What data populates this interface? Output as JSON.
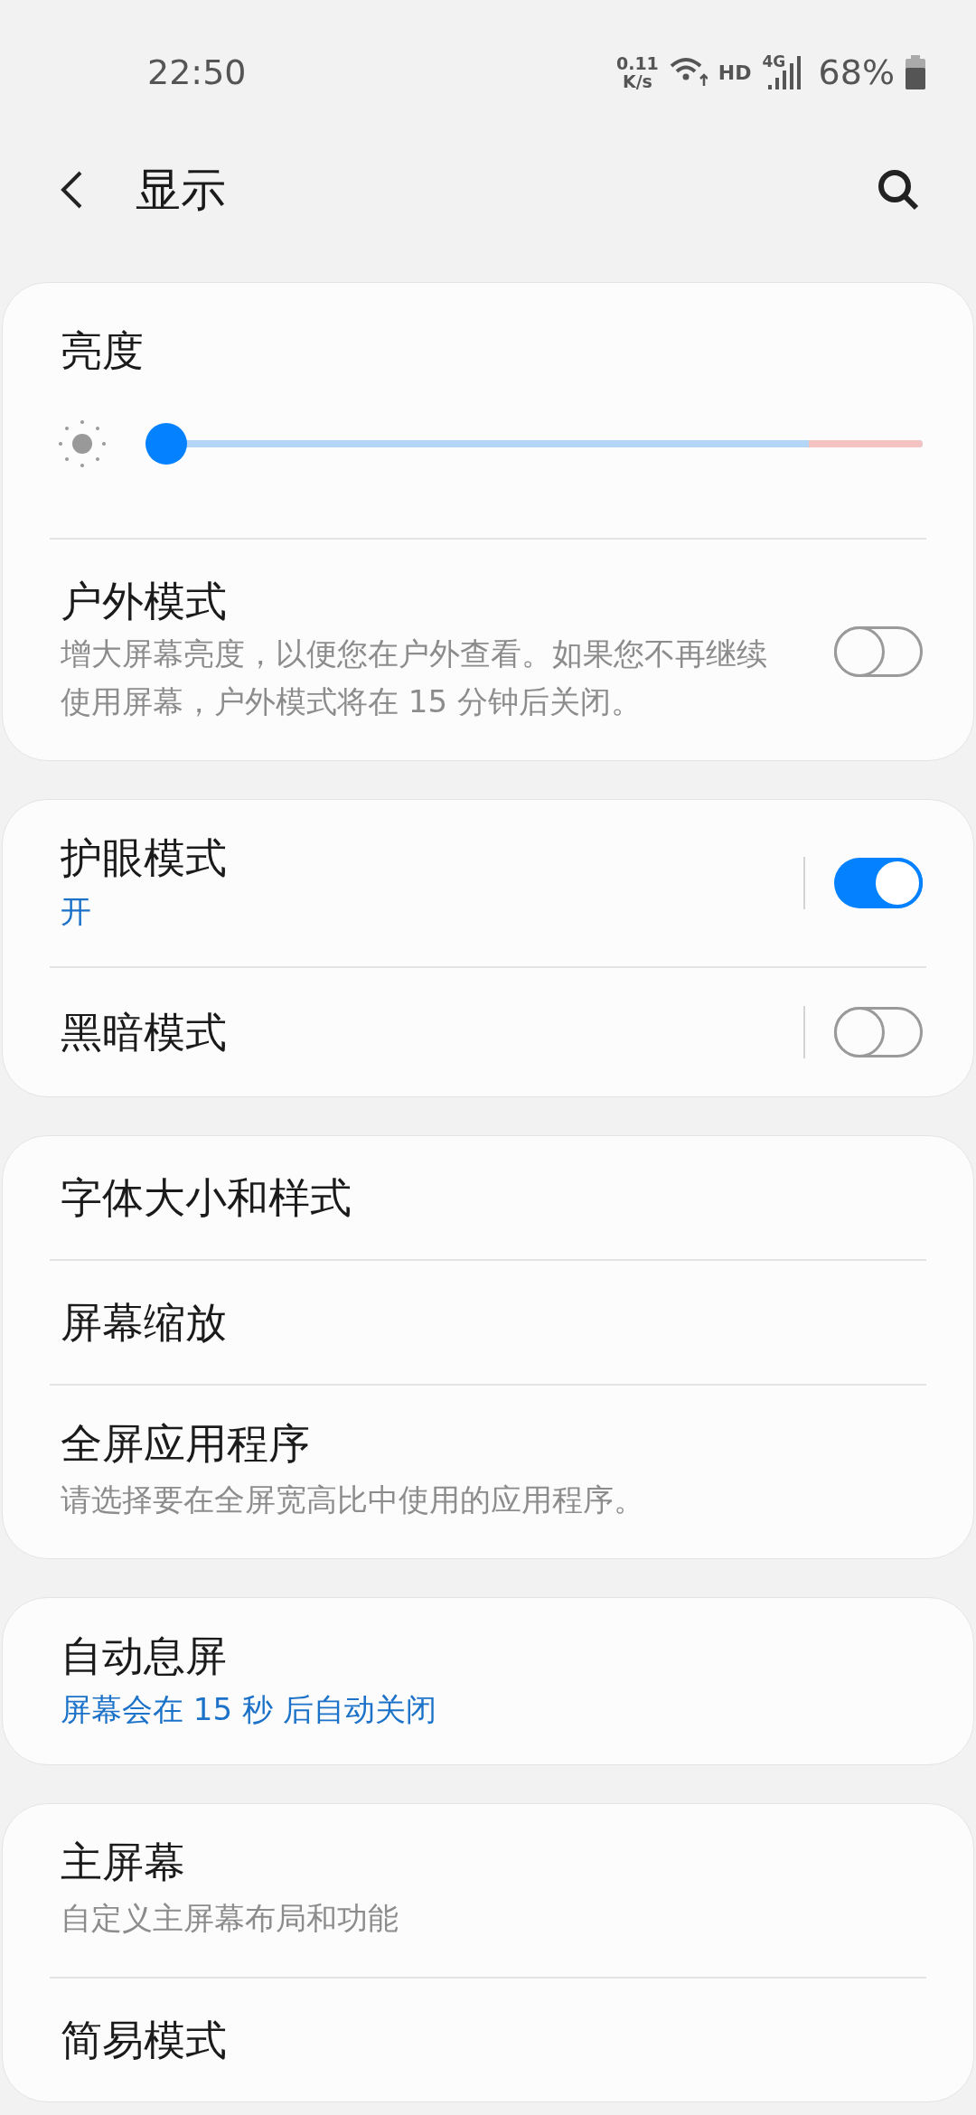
{
  "status_bar": {
    "time": "22:50",
    "net_speed": "0.11",
    "net_unit": "K/s",
    "hd": "HD",
    "network": "4G",
    "battery": "68%"
  },
  "header": {
    "title": "显示"
  },
  "sections": [
    {
      "items": [
        {
          "kind": "slider",
          "title": "亮度",
          "level": 0
        },
        {
          "kind": "switch",
          "title": "户外模式",
          "description": "增大屏幕亮度，以便您在户外查看。如果您不再继续使用屏幕，户外模式将在 15 分钟后关闭。",
          "on": false
        }
      ]
    },
    {
      "items": [
        {
          "kind": "split_switch",
          "title": "护眼模式",
          "status": "开",
          "on": true
        },
        {
          "kind": "split_switch",
          "title": "黑暗模式",
          "on": false
        }
      ]
    },
    {
      "items": [
        {
          "kind": "link",
          "title": "字体大小和样式"
        },
        {
          "kind": "link",
          "title": "屏幕缩放"
        },
        {
          "kind": "link",
          "title": "全屏应用程序",
          "description": "请选择要在全屏宽高比中使用的应用程序。"
        }
      ]
    },
    {
      "items": [
        {
          "kind": "link",
          "title": "自动息屏",
          "status": "屏幕会在 15 秒 后自动关闭"
        }
      ]
    },
    {
      "items": [
        {
          "kind": "link",
          "title": "主屏幕",
          "description": "自定义主屏幕布局和功能"
        },
        {
          "kind": "link",
          "title": "简易模式"
        }
      ]
    }
  ]
}
